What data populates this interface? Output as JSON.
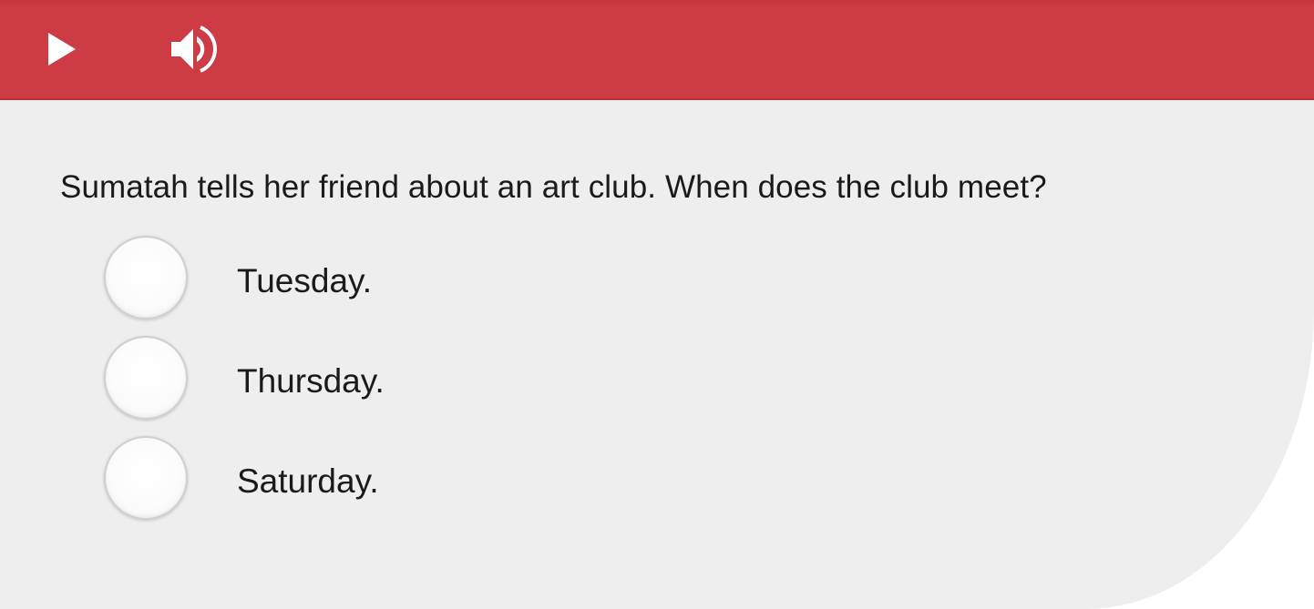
{
  "toolbar": {
    "play_icon": "play-icon",
    "audio_icon": "speaker-icon",
    "background_color": "#cd3b44"
  },
  "question": {
    "text": "Sumatah tells her friend about an art club. When does the club meet?"
  },
  "options": [
    {
      "label": "Tuesday.",
      "selected": false
    },
    {
      "label": "Thursday.",
      "selected": false
    },
    {
      "label": "Saturday.",
      "selected": false
    }
  ]
}
